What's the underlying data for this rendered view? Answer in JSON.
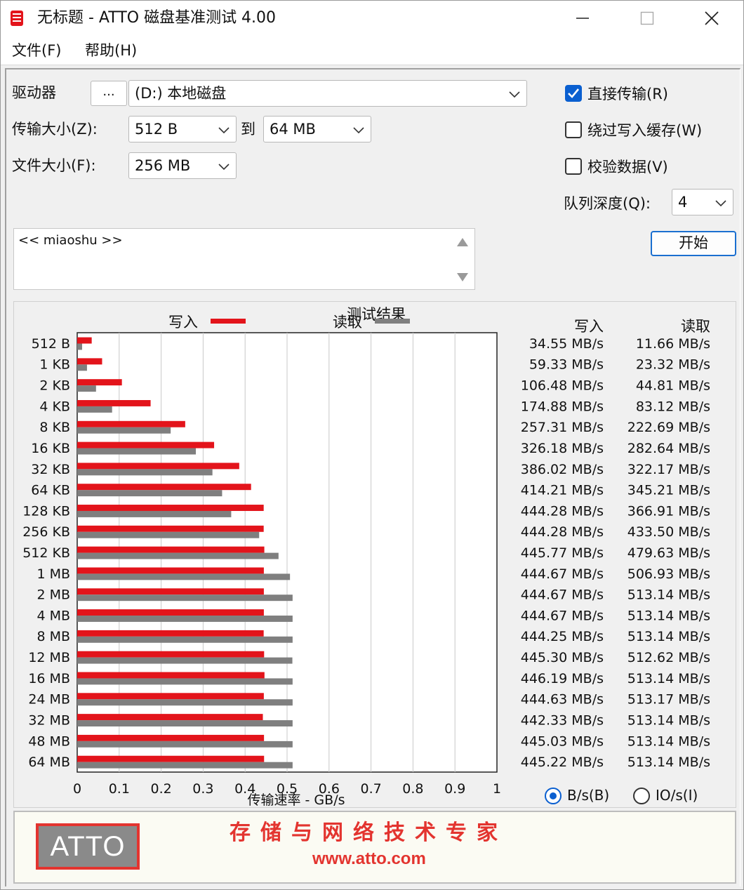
{
  "window": {
    "title": "无标题 - ATTO 磁盘基准测试 4.00"
  },
  "menu": {
    "file": "文件(F)",
    "help": "帮助(H)"
  },
  "settings": {
    "drive_label": "驱动器",
    "browse_label": "...",
    "drive_value": "(D:) 本地磁盘",
    "transfer_label": "传输大小(Z):",
    "transfer_from": "512 B",
    "to_label": "到",
    "transfer_to": "64 MB",
    "file_size_label": "文件大小(F):",
    "file_size": "256 MB",
    "direct_io_label": "直接传输(R)",
    "direct_io_checked": true,
    "bypass_cache_label": "绕过写入缓存(W)",
    "bypass_cache_checked": false,
    "verify_label": "校验数据(V)",
    "verify_checked": false,
    "queue_label": "队列深度(Q):",
    "queue_value": "4",
    "start_label": "开始"
  },
  "description": {
    "text": "<< miaoshu >>"
  },
  "units": {
    "bytes_label": "B/s(B)",
    "io_label": "IO/s(I)",
    "selected": "bytes"
  },
  "banner": {
    "logo": "ATTO",
    "slogan": "存储与网络技术专家",
    "website": "www.atto.com"
  },
  "chart_data": {
    "type": "bar",
    "orientation": "horizontal",
    "title": "测试结果",
    "xlabel": "传输速率 - GB/s",
    "xlim": [
      0,
      1
    ],
    "xticks": [
      "0",
      "0.1",
      "0.2",
      "0.3",
      "0.4",
      "0.5",
      "0.6",
      "0.7",
      "0.8",
      "0.9",
      "1"
    ],
    "grid": true,
    "categories": [
      "512 B",
      "1 KB",
      "2 KB",
      "4 KB",
      "8 KB",
      "16 KB",
      "32 KB",
      "64 KB",
      "128 KB",
      "256 KB",
      "512 KB",
      "1 MB",
      "2 MB",
      "4 MB",
      "8 MB",
      "12 MB",
      "16 MB",
      "24 MB",
      "32 MB",
      "48 MB",
      "64 MB"
    ],
    "table_headers": {
      "write": "写入",
      "read": "读取"
    },
    "series": [
      {
        "name": "写入",
        "color": "#e3141b",
        "values": [
          34.55,
          59.33,
          106.48,
          174.88,
          257.31,
          326.18,
          386.02,
          414.21,
          444.28,
          444.28,
          445.77,
          444.67,
          444.67,
          444.67,
          444.25,
          445.3,
          446.19,
          444.63,
          442.33,
          445.03,
          445.22
        ],
        "labels": [
          "34.55 MB/s",
          "59.33 MB/s",
          "106.48 MB/s",
          "174.88 MB/s",
          "257.31 MB/s",
          "326.18 MB/s",
          "386.02 MB/s",
          "414.21 MB/s",
          "444.28 MB/s",
          "444.28 MB/s",
          "445.77 MB/s",
          "444.67 MB/s",
          "444.67 MB/s",
          "444.67 MB/s",
          "444.25 MB/s",
          "445.30 MB/s",
          "446.19 MB/s",
          "444.63 MB/s",
          "442.33 MB/s",
          "445.03 MB/s",
          "445.22 MB/s"
        ]
      },
      {
        "name": "读取",
        "color": "#7f7f7f",
        "values": [
          11.66,
          23.32,
          44.81,
          83.12,
          222.69,
          282.64,
          322.17,
          345.21,
          366.91,
          433.5,
          479.63,
          506.93,
          513.14,
          513.14,
          513.14,
          512.62,
          513.14,
          513.17,
          513.14,
          513.14,
          513.14
        ],
        "labels": [
          "11.66 MB/s",
          "23.32 MB/s",
          "44.81 MB/s",
          "83.12 MB/s",
          "222.69 MB/s",
          "282.64 MB/s",
          "322.17 MB/s",
          "345.21 MB/s",
          "366.91 MB/s",
          "433.50 MB/s",
          "479.63 MB/s",
          "506.93 MB/s",
          "513.14 MB/s",
          "513.14 MB/s",
          "513.14 MB/s",
          "512.62 MB/s",
          "513.14 MB/s",
          "513.17 MB/s",
          "513.14 MB/s",
          "513.14 MB/s",
          "513.14 MB/s"
        ]
      }
    ]
  }
}
